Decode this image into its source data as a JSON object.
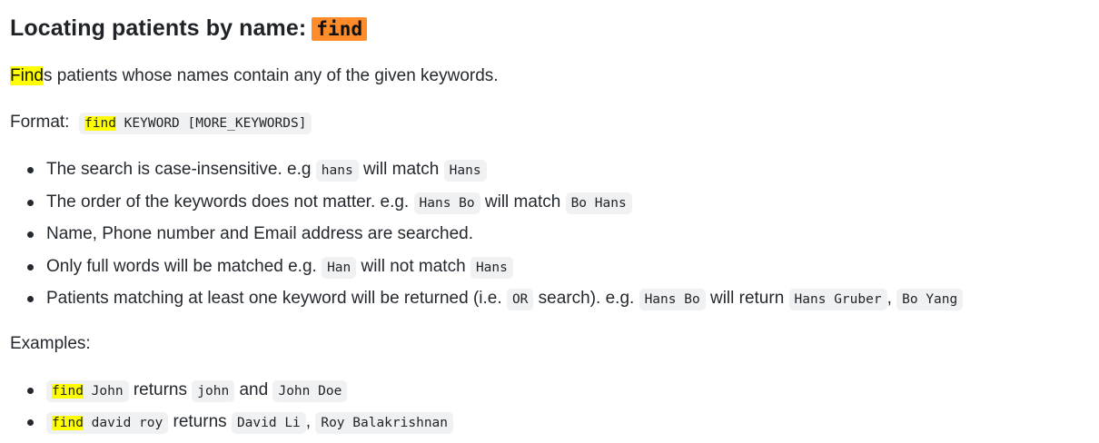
{
  "heading": {
    "text": "Locating patients by name:",
    "command": "find"
  },
  "intro": {
    "highlight": "Find",
    "rest": "s patients whose names contain any of the given keywords."
  },
  "format": {
    "label": "Format:",
    "command": "find",
    "args": " KEYWORD [MORE_KEYWORDS]"
  },
  "rules": [
    {
      "t1": "The search is case-insensitive. e.g ",
      "c1": "hans",
      "t2": " will match ",
      "c2": "Hans"
    },
    {
      "t1": "The order of the keywords does not matter. e.g. ",
      "c1": "Hans Bo",
      "t2": " will match ",
      "c2": "Bo Hans"
    },
    {
      "t1": "Name, Phone number and Email address are searched."
    },
    {
      "t1": "Only full words will be matched e.g. ",
      "c1": "Han",
      "t2": " will not match ",
      "c2": "Hans"
    },
    {
      "t1": "Patients matching at least one keyword will be returned (i.e. ",
      "c1": "OR",
      "t2": " search). e.g. ",
      "c2": "Hans Bo",
      "t3": " will return ",
      "c3": "Hans Gruber",
      "t4": ", ",
      "c4": "Bo Yang"
    }
  ],
  "examples_label": "Examples:",
  "examples": [
    {
      "command": "find",
      "args": " John",
      "t1": " returns ",
      "c1": "john",
      "t2": " and ",
      "c2": "John Doe"
    },
    {
      "command": "find",
      "args": " david roy",
      "t1": " returns ",
      "c1": "David Li",
      "t2": ", ",
      "c2": "Roy Balakrishnan"
    }
  ]
}
